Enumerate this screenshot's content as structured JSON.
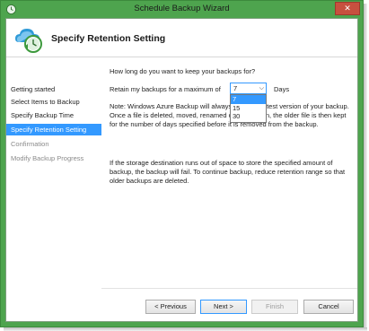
{
  "window": {
    "title": "Schedule Backup Wizard",
    "close_glyph": "✕"
  },
  "header": {
    "title": "Specify Retention Setting",
    "icon": "backup-clock-icon"
  },
  "nav": {
    "items": [
      {
        "label": "Getting started",
        "state": "normal"
      },
      {
        "label": "Select Items to Backup",
        "state": "normal"
      },
      {
        "label": "Specify Backup Time",
        "state": "normal"
      },
      {
        "label": "Specify Retention Setting",
        "state": "active"
      },
      {
        "label": "Confirmation",
        "state": "disabled"
      },
      {
        "label": "Modify Backup Progress",
        "state": "disabled"
      }
    ]
  },
  "content": {
    "question": "How long do you want to keep your backups for?",
    "retain_label": "Retain my backups for a maximum of",
    "retain_value": "7",
    "days_label": "Days",
    "dropdown_options": [
      "7",
      "15",
      "30"
    ],
    "dropdown_selected": "7",
    "note": "Note: Windows Azure Backup will always keep the latest version of your backup. Once a file is deleted, moved, renamed or overwritten, the older file is then kept for the number of days specified before it is removed from the backup.",
    "note_visible": "Note: Windows Azure Backup will always k",
    "note_visible_right": "t version of your backup. Once",
    "note_line2_left": "a file is deleted, moved, renamed or overw",
    "note_line2_right": "lder file is then kept for the",
    "note_line3": "number of days specified before it is removed from the backup.",
    "storage": "If the storage destination runs out of space to store the specified amount of backup, the backup will fail. To continue backup, reduce retention range so that older backups are deleted."
  },
  "buttons": {
    "previous": "< Previous",
    "next": "Next >",
    "finish": "Finish",
    "cancel": "Cancel"
  },
  "colors": {
    "frame": "#4ea44e",
    "accent": "#3399ff",
    "close": "#c7503f"
  }
}
